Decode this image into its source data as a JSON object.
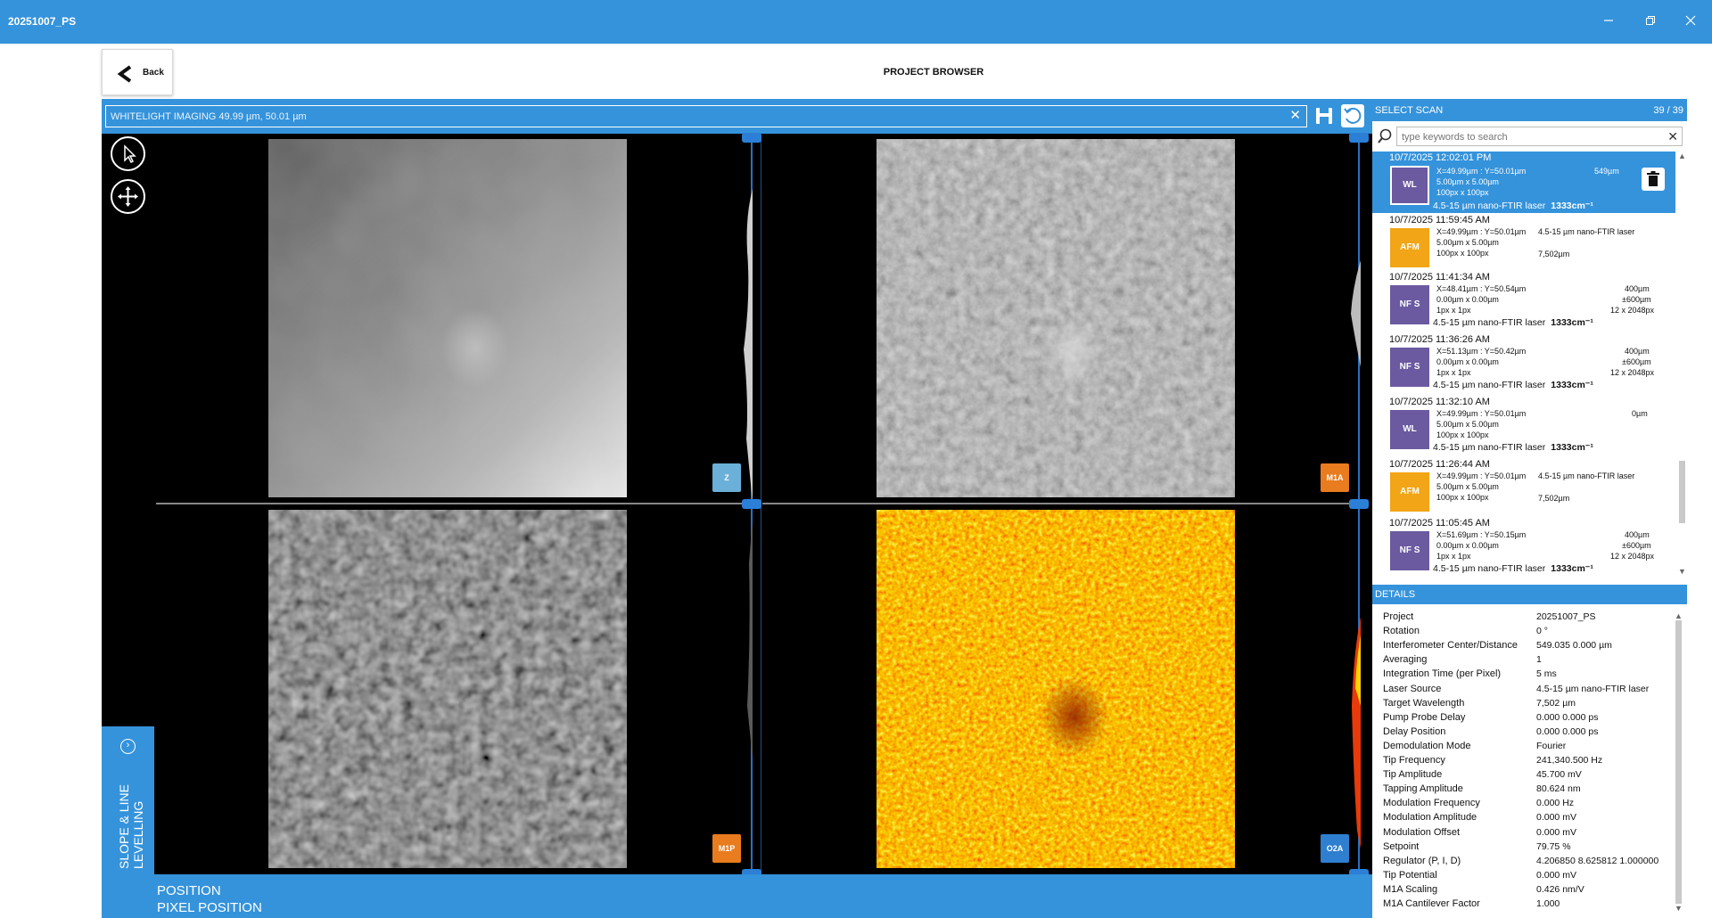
{
  "window": {
    "title": "20251007_PS"
  },
  "header": {
    "back_label": "Back",
    "page_title": "PROJECT BROWSER"
  },
  "imaging": {
    "field_text": "WHITELIGHT IMAGING 49.99 µm, 50.01 µm"
  },
  "channels": {
    "tl": "Z",
    "tr": "M1A",
    "bl": "M1P",
    "br": "O2A"
  },
  "colors": {
    "accent": "#3593db",
    "badge_z": "#6ab0d8",
    "badge_m1a": "#e87c1e",
    "badge_m1p": "#e87c1e",
    "badge_o2a": "#2f7fd0",
    "thumb_wl": "#6b5aa0",
    "thumb_afm": "#f2a516",
    "thumb_nfs": "#6b5aa0"
  },
  "levelling": {
    "label": "SLOPE & LINE LEVELLING"
  },
  "position": {
    "line1": "POSITION",
    "line2": "PIXEL POSITION"
  },
  "scan_panel": {
    "title": "SELECT SCAN",
    "count": "39 / 39",
    "search_placeholder": "type keywords to search",
    "items": [
      {
        "date": "10/7/2025 12:02:01 PM",
        "type": "WL",
        "coords": "X=49.99µm  : Y=50.01µm",
        "size": "5.00µm x       5.00µm",
        "px": "100px x       100px",
        "right1": "549µm",
        "right2": "",
        "right3": "",
        "laser": "4.5-15 µm nano-FTIR laser",
        "wn": "1333cm⁻¹",
        "selected": true
      },
      {
        "date": "10/7/2025 11:59:45 AM",
        "type": "AFM",
        "coords": "X=49.99µm  : Y=50.01µm",
        "size": "5.00µm x       5.00µm",
        "px": "100px x       100px",
        "extra_laser": "4.5-15 µm nano-FTIR laser",
        "extra_wl": "7,502µm",
        "selected": false
      },
      {
        "date": "10/7/2025 11:41:34 AM",
        "type": "NF S",
        "coords": "X=48.41µm  : Y=50.54µm",
        "size": "0.00µm x       0.00µm",
        "px": "1px x       1px",
        "right1": "400µm",
        "right2": "±600µm",
        "right3": "12 x 2048px",
        "laser": "4.5-15 µm nano-FTIR laser",
        "wn": "1333cm⁻¹",
        "selected": false
      },
      {
        "date": "10/7/2025 11:36:26 AM",
        "type": "NF S",
        "coords": "X=51.13µm  : Y=50.42µm",
        "size": "0.00µm x       0.00µm",
        "px": "1px x       1px",
        "right1": "400µm",
        "right2": "±600µm",
        "right3": "12 x 2048px",
        "laser": "4.5-15 µm nano-FTIR laser",
        "wn": "1333cm⁻¹",
        "selected": false
      },
      {
        "date": "10/7/2025 11:32:10 AM",
        "type": "WL",
        "coords": "X=49.99µm  : Y=50.01µm",
        "size": "5.00µm x       5.00µm",
        "px": "100px x       100px",
        "right1": "0µm",
        "right2": "",
        "right3": "",
        "laser": "4.5-15 µm nano-FTIR laser",
        "wn": "1333cm⁻¹",
        "selected": false
      },
      {
        "date": "10/7/2025 11:26:44 AM",
        "type": "AFM",
        "coords": "X=49.99µm  : Y=50.01µm",
        "size": "5.00µm x       5.00µm",
        "px": "100px x       100px",
        "extra_laser": "4.5-15 µm nano-FTIR laser",
        "extra_wl": "7,502µm",
        "selected": false
      },
      {
        "date": "10/7/2025 11:05:45 AM",
        "type": "NF S",
        "coords": "X=51.69µm  : Y=50.15µm",
        "size": "0.00µm x       0.00µm",
        "px": "1px x       1px",
        "right1": "400µm",
        "right2": "±600µm",
        "right3": "12 x 2048px",
        "laser": "4.5-15 µm nano-FTIR laser",
        "wn": "1333cm⁻¹",
        "selected": false
      }
    ]
  },
  "details": {
    "title": "DETAILS",
    "rows": [
      {
        "k": "Project",
        "v": "20251007_PS"
      },
      {
        "k": "Rotation",
        "v": "0 °"
      },
      {
        "k": "Interferometer Center/Distance",
        "v": "549.035  0.000  µm"
      },
      {
        "k": "Averaging",
        "v": "1"
      },
      {
        "k": "Integration Time (per Pixel)",
        "v": "5  ms"
      },
      {
        "k": "Laser Source",
        "v": "4.5-15 µm nano-FTIR laser"
      },
      {
        "k": "Target Wavelength",
        "v": "7,502 µm"
      },
      {
        "k": "Pump Probe Delay",
        "v": "0.000  0.000  ps"
      },
      {
        "k": "Delay Position",
        "v": "0.000  0.000  ps"
      },
      {
        "k": "Demodulation Mode",
        "v": "Fourier"
      },
      {
        "k": "Tip Frequency",
        "v": "241,340.500  Hz"
      },
      {
        "k": "Tip Amplitude",
        "v": "45.700  mV"
      },
      {
        "k": "Tapping Amplitude",
        "v": "80.624  nm"
      },
      {
        "k": "Modulation Frequency",
        "v": "0.000  Hz"
      },
      {
        "k": "Modulation Amplitude",
        "v": "0.000  mV"
      },
      {
        "k": "Modulation Offset",
        "v": "0.000  mV"
      },
      {
        "k": "Setpoint",
        "v": "79.75  %"
      },
      {
        "k": "Regulator (P, I, D)",
        "v": "4.206850  8.625812  1.000000"
      },
      {
        "k": "Tip Potential",
        "v": "0.000  mV"
      },
      {
        "k": "M1A Scaling",
        "v": "0.426  nm/V"
      },
      {
        "k": "M1A Cantilever Factor",
        "v": "1.000"
      }
    ]
  }
}
